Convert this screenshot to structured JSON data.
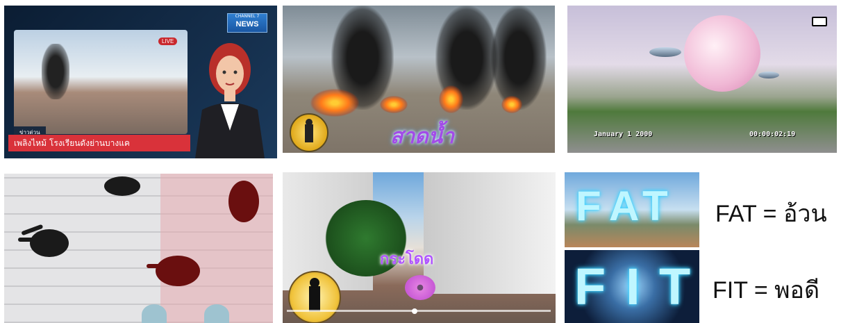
{
  "panel_news": {
    "brand_channel": "CHANNEL 7",
    "brand_news": "NEWS",
    "live": "LIVE",
    "tag": "ข่าวด่วน",
    "headline": "เพลิงไหม้ โรงเรียนดังย่านบางแค"
  },
  "panel_fire": {
    "word": "สาดน้ำ"
  },
  "panel_camcorder": {
    "date": "January 1 2000",
    "timecode": "00:00:02:19"
  },
  "panel_video": {
    "word": "กระโดด"
  },
  "vocab": [
    {
      "word": "FAT",
      "equals": "=",
      "meaning": "อ้วน",
      "neon": [
        "F",
        "A",
        "T"
      ]
    },
    {
      "word": "FIT",
      "equals": "=",
      "meaning": "พอดี",
      "neon": [
        "F",
        "I",
        "T"
      ]
    }
  ],
  "colors": {
    "ticker_red": "#d9323a",
    "neon_purple": "#a24be8",
    "neon_cyan": "#3ad1ff"
  }
}
